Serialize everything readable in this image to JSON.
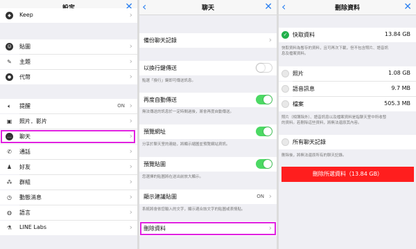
{
  "panel1": {
    "title": "設定",
    "close_icon": "close-icon",
    "items": [
      {
        "label": "Keep",
        "icon": "keep-icon"
      },
      {
        "label": "貼圖",
        "icon": "sticker-icon"
      },
      {
        "label": "主題",
        "icon": "theme-icon"
      },
      {
        "label": "代幣",
        "icon": "coin-icon"
      },
      {
        "label": "提醒",
        "icon": "speaker-icon",
        "value": "ON"
      },
      {
        "label": "照片．影片",
        "icon": "photo-icon"
      },
      {
        "label": "聊天",
        "icon": "chat-bubble-icon"
      },
      {
        "label": "通話",
        "icon": "phone-icon"
      },
      {
        "label": "好友",
        "icon": "friend-icon"
      },
      {
        "label": "群組",
        "icon": "group-icon"
      },
      {
        "label": "動態消息",
        "icon": "timeline-icon"
      },
      {
        "label": "語言",
        "icon": "globe-icon"
      },
      {
        "label": "LINE Labs",
        "icon": "labs-icon"
      }
    ]
  },
  "panel2": {
    "title": "聊天",
    "backup": "備份聊天記錄",
    "enter_send": "以換行鍵傳送",
    "enter_send_desc": "點選「換行」鍵即可傳送訊息。",
    "resend": "再度自動傳送",
    "resend_desc": "無法傳送的訊息於一定時間過後，將會再度自動傳送。",
    "link_preview": "預覽網址",
    "link_preview_desc": "分享於聊天室的連結，將顯示縮圖並預覽網站資訊。",
    "sticker_preview": "預覽貼圖",
    "sticker_preview_desc": "您選擇的貼圖將在送出前放大顯示。",
    "suggest": "顯示建議貼圖",
    "suggest_value": "ON",
    "suggest_desc": "系統將會依您輸入的文字，顯示適合該文字的貼圖或表情貼。",
    "delete": "刪除資料"
  },
  "panel3": {
    "title": "刪除資料",
    "cache": {
      "label": "快取資料",
      "value": "13.84 GB"
    },
    "cache_desc_1": "快取資料為暫存的資料，且可再次下載，但不包含照片、語音訊",
    "cache_desc_2": "息及檔案資料。",
    "photos": {
      "label": "照片",
      "value": "1.08 GB"
    },
    "voice": {
      "label": "語音訊息",
      "value": "9.7 MB"
    },
    "files": {
      "label": "檔案",
      "value": "505.3 MB"
    },
    "media_desc_1": "照片（相簿除外）、語音訊息以及檔案資料是指聊天室中所收發",
    "media_desc_2": "的資料。若刪除這些資料，將無法還原其內容。",
    "all_chats": "所有聊天記錄",
    "all_chats_desc": "刪除後，將無法還原所有的聊天記錄。",
    "delete_button": "刪除所選資料（13.84 GB）",
    "colors": {
      "accent": "#2a7ff0",
      "danger": "#ff1e1e",
      "toggle_on": "#4cd964",
      "highlight": "#e020e0"
    }
  }
}
